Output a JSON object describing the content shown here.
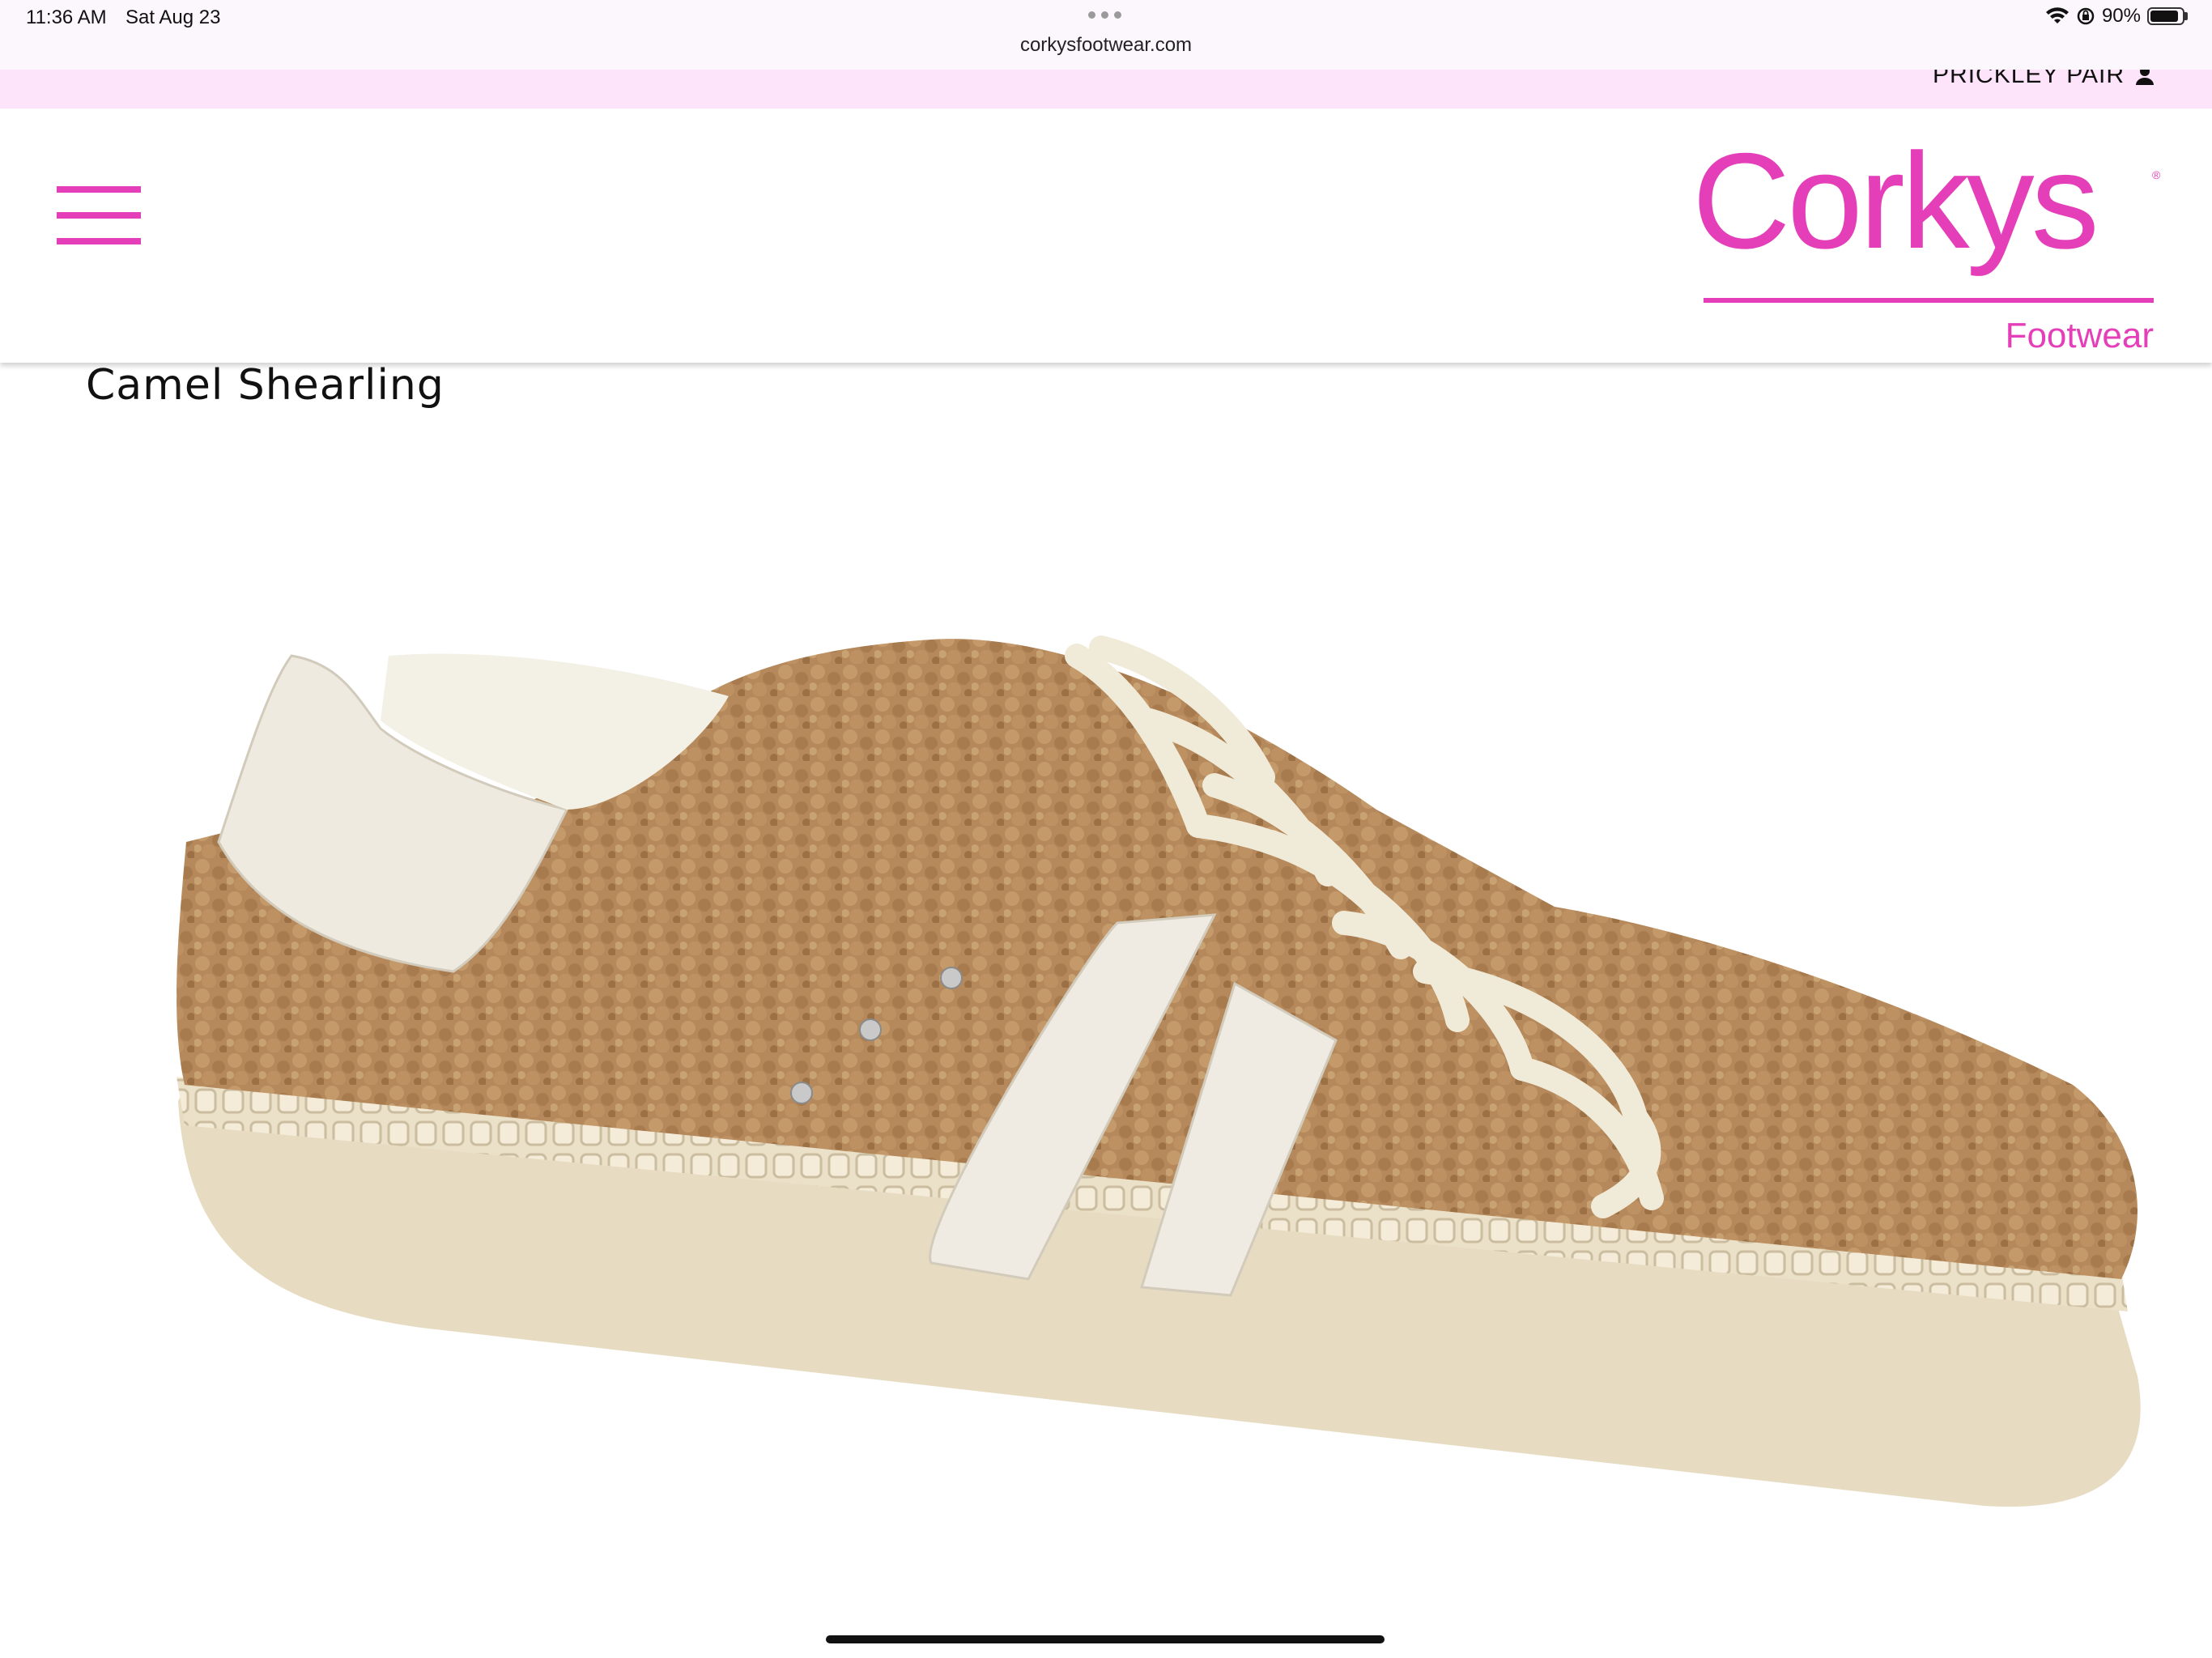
{
  "status_bar": {
    "time": "11:36 AM",
    "date": "Sat Aug 23",
    "url": "corkysfootwear.com",
    "battery": "90%",
    "battery_level": 0.9,
    "icons": [
      "wifi-icon",
      "lock-rotation-icon",
      "battery-icon"
    ]
  },
  "promo": {
    "link_label": "PRICKLEY PAIR",
    "icon": "person-icon"
  },
  "header": {
    "menu_icon": "hamburger-menu-icon",
    "logo_word": "Corkys",
    "logo_sub": "Footwear",
    "logo_mark": "®",
    "brand_color": "#e43fb8"
  },
  "product": {
    "title": "Camel Shearling"
  }
}
